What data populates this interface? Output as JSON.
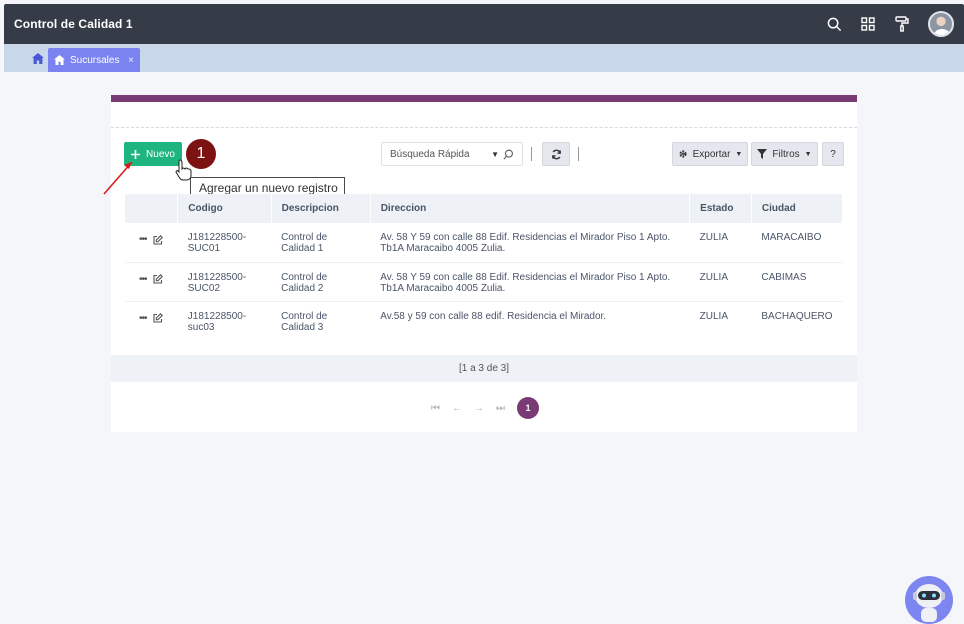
{
  "app": {
    "title": "Control de Calidad 1"
  },
  "tabs": [
    {
      "label": "Sucursales",
      "close": "×"
    }
  ],
  "toolbar": {
    "nuevo_label": "Nuevo",
    "step_badge": "1",
    "tooltip": "Agregar un nuevo registro",
    "search_placeholder": "Búsqueda Rápida",
    "exportar_label": "Exportar",
    "filtros_label": "Filtros",
    "help_label": "?"
  },
  "table": {
    "columns": [
      "",
      "Codigo",
      "Descripcion",
      "Direccion",
      "Estado",
      "Ciudad"
    ],
    "rows": [
      {
        "codigo": "J181228500-SUC01",
        "descripcion": "Control de Calidad 1",
        "direccion": "Av. 58 Y 59 con calle 88 Edif. Residencias el Mirador Piso 1 Apto. Tb1A Maracaibo 4005 Zulia.",
        "estado": "ZULIA",
        "ciudad": "MARACAIBO"
      },
      {
        "codigo": "J181228500-SUC02",
        "descripcion": "Control de Calidad 2",
        "direccion": "Av. 58 Y 59 con calle 88 Edif. Residencias el Mirador Piso 1 Apto. Tb1A Maracaibo 4005 Zulia.",
        "estado": "ZULIA",
        "ciudad": "CABIMAS"
      },
      {
        "codigo": "J181228500-suc03",
        "descripcion": "Control de Calidad 3",
        "direccion": "Av.58 y 59 con calle 88 edif. Residencia el Mirador.",
        "estado": "ZULIA",
        "ciudad": "BACHAQUERO"
      }
    ]
  },
  "pagination": {
    "summary": "[1 a 3 de 3]",
    "current_page": "1"
  },
  "colors": {
    "topbar": "#353c48",
    "accent": "#7a3a74",
    "primary_button": "#1fb57f",
    "tab": "#7b83f0",
    "badge": "#7d1212"
  },
  "icons": [
    "search-icon",
    "apps-grid-icon",
    "paint-roller-icon",
    "home-icon",
    "refresh-icon",
    "gear-icon",
    "filter-icon",
    "edit-icon",
    "robot-icon"
  ]
}
